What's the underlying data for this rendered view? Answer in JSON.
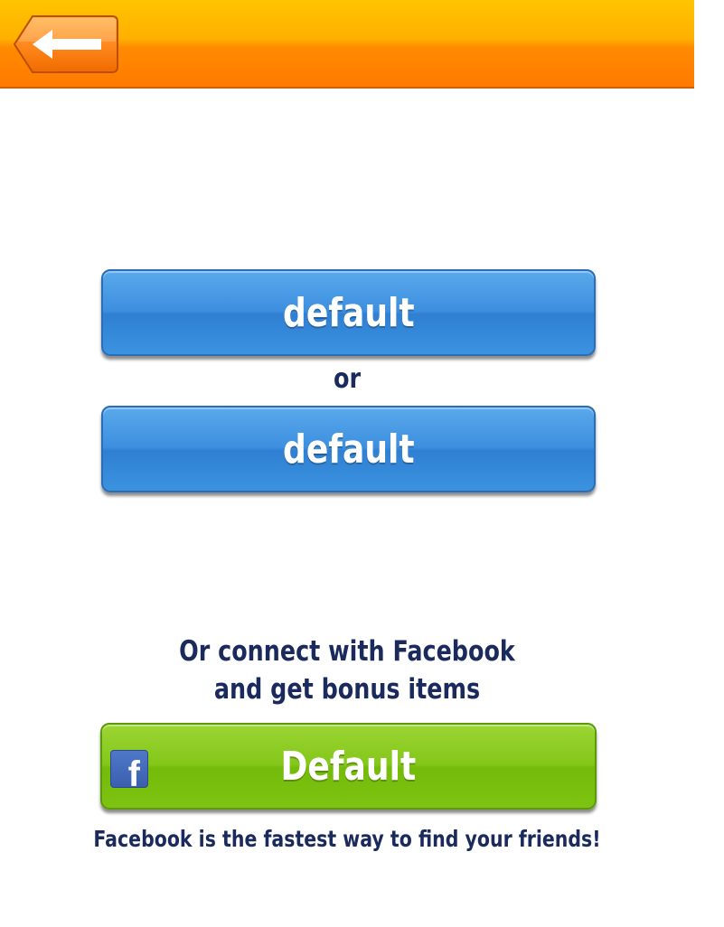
{
  "header": {
    "back_icon": "back-arrow-icon",
    "colors": {
      "bar_top": "#ffc400",
      "bar_bottom": "#ff7a00"
    }
  },
  "main": {
    "primary_button_label": "default",
    "separator": "or",
    "secondary_button_label": "default"
  },
  "facebook": {
    "prompt_line1": "Or connect with Facebook",
    "prompt_line2": "and get bonus items",
    "button_label": "Default",
    "icon_letter": "f",
    "note": "Facebook is the fastest way to find your friends!",
    "colors": {
      "button": "#84c71a",
      "icon": "#3b5fae"
    }
  },
  "colors": {
    "blue_button": "#3d8fdf",
    "text_dark": "#1a2a5c"
  }
}
